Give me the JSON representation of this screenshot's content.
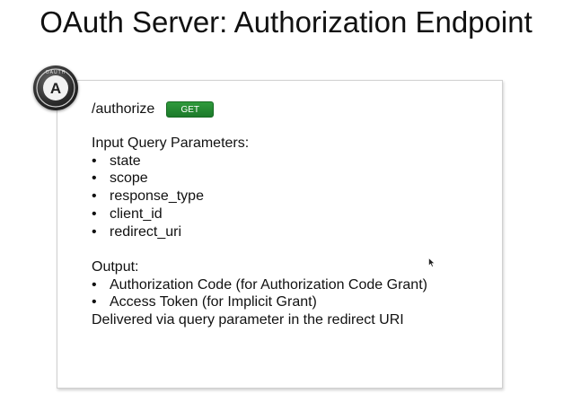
{
  "slide": {
    "title": "OAuth Server: Authorization Endpoint"
  },
  "logo": {
    "icon": "oauth-logo-icon",
    "ring_text": "OAUTH",
    "letter": "A"
  },
  "endpoint": {
    "path": "/authorize",
    "method": "GET"
  },
  "input": {
    "heading": "Input Query Parameters:",
    "items": [
      {
        "bullet": "•",
        "label": "state"
      },
      {
        "bullet": "•",
        "label": "scope"
      },
      {
        "bullet": "•",
        "label": "response_type"
      },
      {
        "bullet": "•",
        "label": "client_id"
      },
      {
        "bullet": "•",
        "label": "redirect_uri"
      }
    ]
  },
  "output": {
    "heading": "Output:",
    "items": [
      {
        "bullet": "•",
        "label": "Authorization Code (for Authorization Code Grant)"
      },
      {
        "bullet": "•",
        "label": "Access Token (for Implicit Grant)"
      }
    ],
    "note": "Delivered via query parameter in the redirect URI"
  },
  "colors": {
    "badge_green": "#1c7a2a",
    "text": "#111111",
    "card_border": "#d0d0d0"
  }
}
